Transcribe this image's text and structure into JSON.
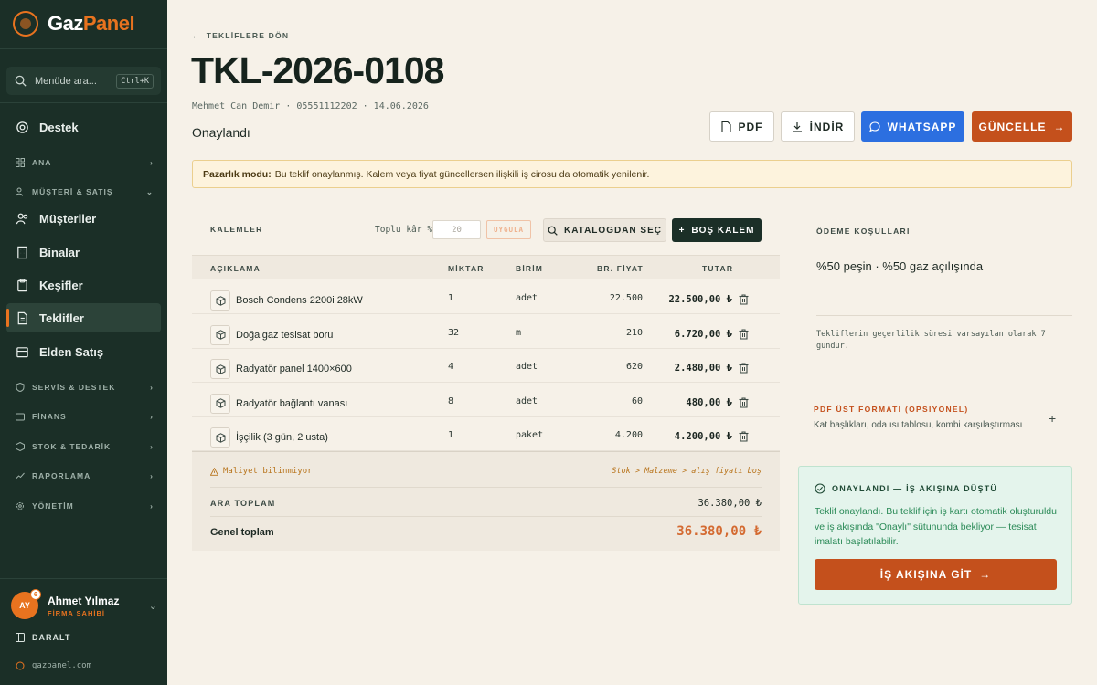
{
  "app": {
    "logo_a": "Gaz",
    "logo_b": "Panel"
  },
  "sidebar": {
    "search_placeholder": "Menüde ara...",
    "search_shortcut": "Ctrl+K",
    "support": "Destek",
    "group_ana": "ANA",
    "group_customer": "MÜŞTERİ & SATIŞ",
    "items": [
      {
        "label": "Müşteriler",
        "icon": "users-icon"
      },
      {
        "label": "Binalar",
        "icon": "building-icon"
      },
      {
        "label": "Keşifler",
        "icon": "clipboard-icon"
      },
      {
        "label": "Teklifler",
        "icon": "document-icon",
        "active": true
      },
      {
        "label": "Elden Satış",
        "icon": "register-icon"
      }
    ],
    "groups": [
      {
        "label": "SERVİS & DESTEK"
      },
      {
        "label": "FİNANS"
      },
      {
        "label": "STOK & TEDARİK"
      },
      {
        "label": "RAPORLAMA"
      },
      {
        "label": "YÖNETİM"
      }
    ],
    "user": {
      "initials": "AY",
      "badge": "6",
      "name": "Ahmet Yılmaz",
      "role": "FİRMA SAHİBİ"
    },
    "collapse": "DARALT",
    "footer": "gazpanel.com"
  },
  "header": {
    "back": "TEKLİFLERE DÖN",
    "title": "TKL-2026-0108",
    "meta": "Mehmet Can Demir · 05551112202 · 14.06.2026",
    "status": "Onaylandı",
    "buttons": {
      "pdf": "PDF",
      "download": "İNDİR",
      "whatsapp": "WHATSAPP",
      "update": "GÜNCELLE"
    }
  },
  "alert": {
    "bold": "Pazarlık modu:",
    "text": "Bu teklif onaylanmış. Kalem veya fiyat güncellersen ilişkili iş cirosu da otomatik yenilenir."
  },
  "items_section": {
    "label": "KALEMLER",
    "bulk_label": "Toplu kâr %",
    "bulk_placeholder": "20",
    "apply": "UYGULA",
    "catalog": "KATALOGDAN SEÇ",
    "empty_item": "BOŞ KALEM",
    "headers": {
      "desc": "AÇIKLAMA",
      "qty": "MİKTAR",
      "unit": "BİRİM",
      "price": "BR. FİYAT",
      "total": "TUTAR"
    },
    "rows": [
      {
        "desc": "Bosch Condens 2200i 28kW",
        "qty": "1",
        "unit": "adet",
        "price": "22.500",
        "total": "22.500,00 ₺"
      },
      {
        "desc": "Doğalgaz tesisat boru",
        "qty": "32",
        "unit": "m",
        "price": "210",
        "total": "6.720,00 ₺"
      },
      {
        "desc": "Radyatör panel 1400×600",
        "qty": "4",
        "unit": "adet",
        "price": "620",
        "total": "2.480,00 ₺"
      },
      {
        "desc": "Radyatör bağlantı vanası",
        "qty": "8",
        "unit": "adet",
        "price": "60",
        "total": "480,00 ₺"
      },
      {
        "desc": "İşçilik (3 gün, 2 usta)",
        "qty": "1",
        "unit": "paket",
        "price": "4.200",
        "total": "4.200,00 ₺"
      }
    ],
    "cost_warning": "Maliyet bilinmiyor",
    "cost_path": "Stok > Malzeme > alış fiyatı boş",
    "subtotal_label": "ARA TOPLAM",
    "subtotal": "36.380,00 ₺",
    "grand_label": "Genel toplam",
    "grand_total": "36.380,00 ₺"
  },
  "right": {
    "payment_label": "ÖDEME KOŞULLARI",
    "payment_text": "%50 peşin · %50 gaz açılışında",
    "validity": "Tekliflerin geçerlilik süresi varsayılan olarak 7 gündür.",
    "pdf_label": "PDF ÜST FORMATI (OPSİYONEL)",
    "pdf_desc": "Kat başlıkları, oda ısı tablosu, kombi karşılaştırması",
    "approved_title": "ONAYLANDI — İŞ AKIŞINA DÜŞTÜ",
    "approved_body": "Teklif onaylandı. Bu teklif için iş kartı otomatik oluşturuldu ve iş akışında \"Onaylı\" sütununda bekliyor — tesisat imalatı başlatılabilir.",
    "workflow_button": "İŞ AKIŞINA GİT"
  },
  "colors": {
    "sidebar": "#1b2f27",
    "accent": "#c4501c",
    "brand": "#e8731f",
    "whatsapp": "#2c6fe0",
    "success": "#2a8a57"
  }
}
